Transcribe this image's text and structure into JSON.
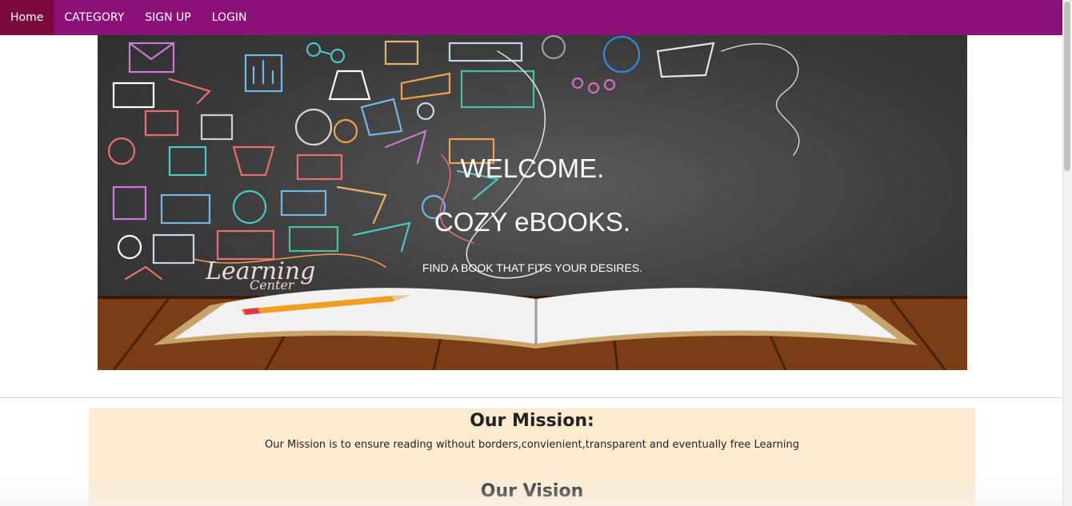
{
  "nav": {
    "items": [
      {
        "label": "Home",
        "active": true
      },
      {
        "label": "CATEGORY",
        "active": false
      },
      {
        "label": "SIGN UP",
        "active": false
      },
      {
        "label": "LOGIN",
        "active": false
      }
    ]
  },
  "hero": {
    "welcome": "WELCOME.",
    "brand": "COZY eBOOKS.",
    "tagline": "FIND A BOOK THAT FITS YOUR DESIRES.",
    "chalk_text_1": "Learning",
    "chalk_text_2": "Center"
  },
  "mission": {
    "title": "Our Mission:",
    "text": "Our Mission is to ensure reading without borders,convienient,transparent and eventually free Learning"
  },
  "vision": {
    "title": "Our Vision"
  },
  "colors": {
    "navbar": "#8b1077",
    "nav_active": "#7a0b3c",
    "mission_bg": "#fdebd0"
  }
}
